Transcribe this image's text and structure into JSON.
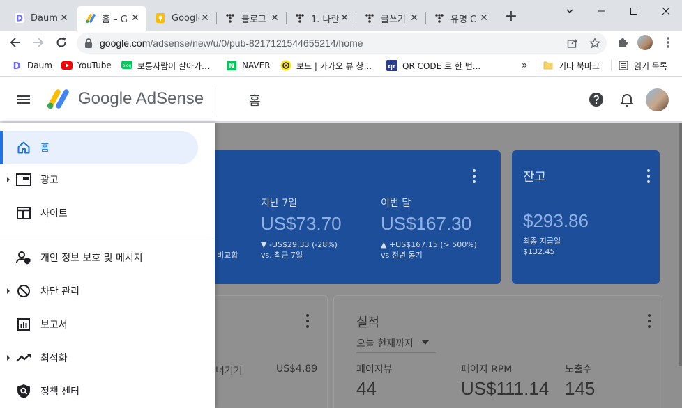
{
  "tabs": [
    {
      "title": "Daum",
      "icon": "daum-icon",
      "active": false
    },
    {
      "title": "홈 – G",
      "icon": "adsense-icon",
      "active": true
    },
    {
      "title": "Google",
      "icon": "google-keep-icon",
      "active": false
    },
    {
      "title": "블로그",
      "icon": "tistory-icon",
      "active": false
    },
    {
      "title": "1. 나란",
      "icon": "tistory-icon",
      "active": false
    },
    {
      "title": "글쓰기",
      "icon": "tistory-icon",
      "active": false
    },
    {
      "title": "유명 C",
      "icon": "tistory-icon",
      "active": false
    }
  ],
  "address_bar": {
    "host": "google.com",
    "path": "/adsense/new/u/0/pub-8217121544655214/home"
  },
  "bookmarks": [
    {
      "label": "Daum",
      "icon": "daum-icon"
    },
    {
      "label": "YouTube",
      "icon": "youtube-icon"
    },
    {
      "label": "보통사람이 살아가...",
      "icon": "naver-blog-icon"
    },
    {
      "label": "NAVER",
      "icon": "naver-icon"
    },
    {
      "label": "보드 | 카카오 뷰 창...",
      "icon": "kakao-view-icon"
    },
    {
      "label": "QR CODE 로 한 번...",
      "icon": "qr-icon"
    }
  ],
  "bookmarks_overflow": "»",
  "bookmarks_other": "기타 북마크",
  "reading_list": "읽기 목록",
  "header": {
    "brand": "Google AdSense",
    "page_title": "홈"
  },
  "nav": {
    "items": [
      {
        "label": "홈",
        "icon": "home-icon",
        "expandable": false,
        "active": true
      },
      {
        "label": "광고",
        "icon": "ads-icon",
        "expandable": true,
        "active": false
      },
      {
        "label": "사이트",
        "icon": "sites-icon",
        "expandable": false,
        "active": false
      },
      {
        "label": "개인 정보 보호 및 메시지",
        "icon": "privacy-icon",
        "expandable": false,
        "active": false
      },
      {
        "label": "차단 관리",
        "icon": "block-icon",
        "expandable": true,
        "active": false
      },
      {
        "label": "보고서",
        "icon": "reports-icon",
        "expandable": false,
        "active": false
      },
      {
        "label": "최적화",
        "icon": "trending-icon",
        "expandable": true,
        "active": false
      },
      {
        "label": "정책 센터",
        "icon": "policy-icon",
        "expandable": false,
        "active": false
      }
    ]
  },
  "earnings_card": {
    "last7_label": "지난 7일",
    "last7_value": "US$73.70",
    "last7_delta": "▼ -US$29.33 (-28%)",
    "last7_compare": "vs. 최근 7일",
    "month_label": "이번 달",
    "month_value": "US$167.30",
    "month_delta": "▲ +US$167.15 (> 500%)",
    "month_compare": "vs 전년 동기",
    "partial_compare": "비교합"
  },
  "balance_card": {
    "title": "잔고",
    "value": "$293.86",
    "last_payment_label": "최종 지급일",
    "last_payment_value": "$132.45"
  },
  "left_card": {
    "partial_label": "너기기",
    "value": "US$4.89"
  },
  "performance_card": {
    "title": "실적",
    "range": "오늘 현재까지",
    "metrics": [
      {
        "label": "페이지뷰",
        "value": "44"
      },
      {
        "label": "페이지 RPM",
        "value": "US$111.14"
      },
      {
        "label": "노출수",
        "value": "145"
      }
    ]
  },
  "colors": {
    "accent": "#1a73e8",
    "active_nav_bg": "#e8f0fe",
    "card_blue": "#1d4e9a"
  }
}
